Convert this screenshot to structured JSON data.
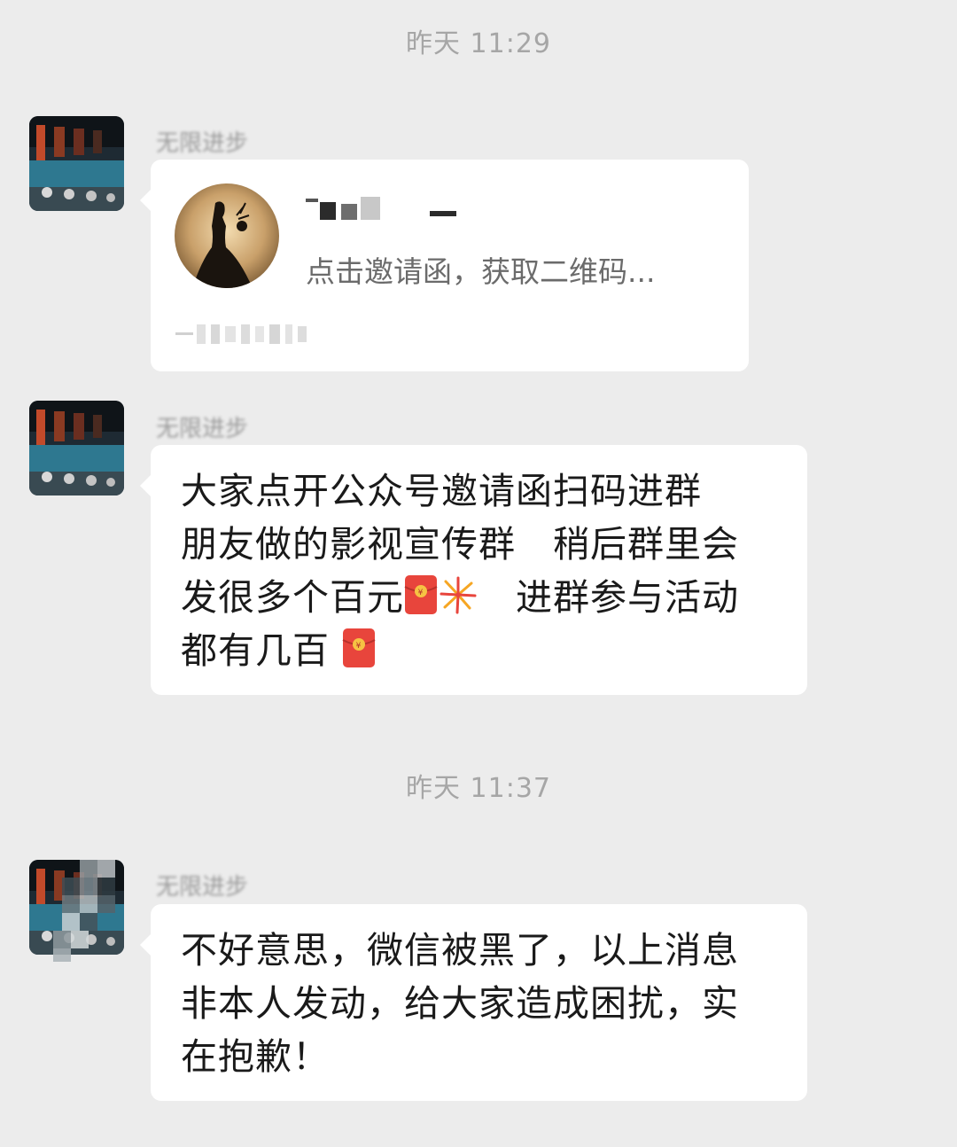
{
  "chat": {
    "timestamp_1": "昨天 11:29",
    "timestamp_2": "昨天 11:37",
    "messages": [
      {
        "sender": "无限进步",
        "type": "card",
        "card_title": "",
        "card_desc": "点击邀请函，获取二维码..."
      },
      {
        "sender": "无限进步",
        "type": "text",
        "line1": "大家点开公众号邀请函扫码进群",
        "line2": "朋友做的影视宣传群　稍后群里会",
        "line3a": "发很多个百元",
        "line3b": "　进群参与活动",
        "line4": "都有几百 "
      },
      {
        "sender": "无限进步",
        "type": "text",
        "line1": "不好意思，微信被黑了，以上消息",
        "line2": "非本人发动，给大家造成困扰，实",
        "line3": "在抱歉！"
      }
    ]
  },
  "icons": {
    "red_packet": "red-packet-icon",
    "fireworks": "fireworks-icon"
  },
  "colors": {
    "background": "#ececec",
    "bubble": "#ffffff",
    "red_packet": "#e8453c",
    "timestamp_text": "#a6a6a6"
  }
}
